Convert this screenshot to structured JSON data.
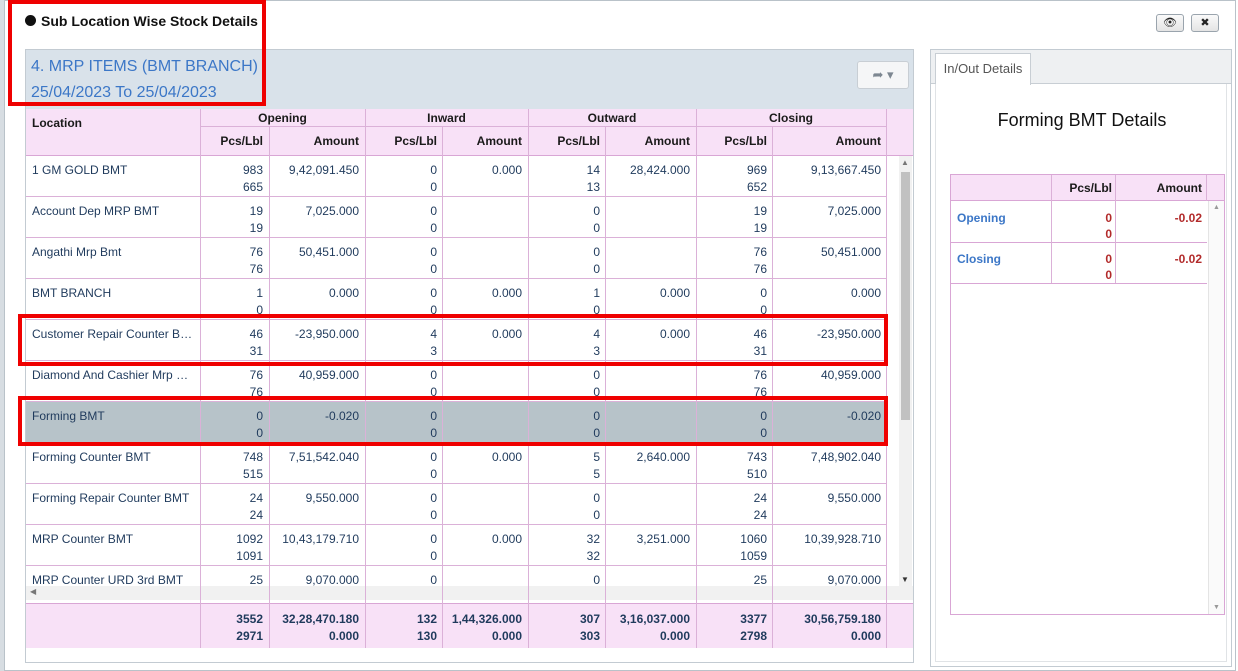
{
  "dialog": {
    "title": "Sub Location Wise Stock Details",
    "btn_view": "👁",
    "btn_close": "✖"
  },
  "panel": {
    "title_line1": "4. MRP ITEMS (BMT BRANCH)",
    "title_line2": "25/04/2023 To 25/04/2023",
    "share_icon": "➦ ▾"
  },
  "grid": {
    "headers": {
      "location": "Location",
      "opening": "Opening",
      "inward": "Inward",
      "outward": "Outward",
      "closing": "Closing",
      "pcs": "Pcs/Lbl",
      "amount": "Amount"
    },
    "rows": [
      {
        "location": "1 GM GOLD BMT",
        "op_pcs": "983",
        "op_lbl": "665",
        "op_amt": "9,42,091.450",
        "in_pcs": "0",
        "in_lbl": "0",
        "in_amt": "0.000",
        "out_pcs": "14",
        "out_lbl": "13",
        "out_amt": "28,424.000",
        "cl_pcs": "969",
        "cl_lbl": "652",
        "cl_amt": "9,13,667.450"
      },
      {
        "location": "Account Dep MRP BMT",
        "op_pcs": "19",
        "op_lbl": "19",
        "op_amt": "7,025.000",
        "in_pcs": "0",
        "in_lbl": "0",
        "in_amt": "",
        "out_pcs": "0",
        "out_lbl": "0",
        "out_amt": "",
        "cl_pcs": "19",
        "cl_lbl": "19",
        "cl_amt": "7,025.000"
      },
      {
        "location": "Angathi Mrp Bmt",
        "op_pcs": "76",
        "op_lbl": "76",
        "op_amt": "50,451.000",
        "in_pcs": "0",
        "in_lbl": "0",
        "in_amt": "",
        "out_pcs": "0",
        "out_lbl": "0",
        "out_amt": "",
        "cl_pcs": "76",
        "cl_lbl": "76",
        "cl_amt": "50,451.000"
      },
      {
        "location": "BMT BRANCH",
        "op_pcs": "1",
        "op_lbl": "0",
        "op_amt": "0.000",
        "in_pcs": "0",
        "in_lbl": "0",
        "in_amt": "0.000",
        "out_pcs": "1",
        "out_lbl": "0",
        "out_amt": "0.000",
        "cl_pcs": "0",
        "cl_lbl": "0",
        "cl_amt": "0.000"
      },
      {
        "location": "Customer Repair Counter BMT",
        "op_pcs": "46",
        "op_lbl": "31",
        "op_amt": "-23,950.000",
        "in_pcs": "4",
        "in_lbl": "3",
        "in_amt": "0.000",
        "out_pcs": "4",
        "out_lbl": "3",
        "out_amt": "0.000",
        "cl_pcs": "46",
        "cl_lbl": "31",
        "cl_amt": "-23,950.000"
      },
      {
        "location": "Diamond And Cashier Mrp BMT",
        "op_pcs": "76",
        "op_lbl": "76",
        "op_amt": "40,959.000",
        "in_pcs": "0",
        "in_lbl": "0",
        "in_amt": "",
        "out_pcs": "0",
        "out_lbl": "0",
        "out_amt": "",
        "cl_pcs": "76",
        "cl_lbl": "76",
        "cl_amt": "40,959.000"
      },
      {
        "location": "Forming BMT",
        "op_pcs": "0",
        "op_lbl": "0",
        "op_amt": "-0.020",
        "in_pcs": "0",
        "in_lbl": "0",
        "in_amt": "",
        "out_pcs": "0",
        "out_lbl": "0",
        "out_amt": "",
        "cl_pcs": "0",
        "cl_lbl": "0",
        "cl_amt": "-0.020"
      },
      {
        "location": "Forming Counter BMT",
        "op_pcs": "748",
        "op_lbl": "515",
        "op_amt": "7,51,542.040",
        "in_pcs": "0",
        "in_lbl": "0",
        "in_amt": "0.000",
        "out_pcs": "5",
        "out_lbl": "5",
        "out_amt": "2,640.000",
        "cl_pcs": "743",
        "cl_lbl": "510",
        "cl_amt": "7,48,902.040"
      },
      {
        "location": "Forming Repair Counter BMT",
        "op_pcs": "24",
        "op_lbl": "24",
        "op_amt": "9,550.000",
        "in_pcs": "0",
        "in_lbl": "0",
        "in_amt": "",
        "out_pcs": "0",
        "out_lbl": "0",
        "out_amt": "",
        "cl_pcs": "24",
        "cl_lbl": "24",
        "cl_amt": "9,550.000"
      },
      {
        "location": "MRP Counter BMT",
        "op_pcs": "1092",
        "op_lbl": "1091",
        "op_amt": "10,43,179.710",
        "in_pcs": "0",
        "in_lbl": "0",
        "in_amt": "0.000",
        "out_pcs": "32",
        "out_lbl": "32",
        "out_amt": "3,251.000",
        "cl_pcs": "1060",
        "cl_lbl": "1059",
        "cl_amt": "10,39,928.710"
      },
      {
        "location": "MRP Counter URD 3rd BMT",
        "op_pcs": "25",
        "op_lbl": "",
        "op_amt": "9,070.000",
        "in_pcs": "0",
        "in_lbl": "",
        "in_amt": "",
        "out_pcs": "0",
        "out_lbl": "",
        "out_amt": "",
        "cl_pcs": "25",
        "cl_lbl": "",
        "cl_amt": "9,070.000"
      }
    ],
    "totals": {
      "op_pcs": "3552",
      "op_lbl": "2971",
      "op_amt": "32,28,470.180",
      "op_amt2": "0.000",
      "in_pcs": "132",
      "in_lbl": "130",
      "in_amt": "1,44,326.000",
      "in_amt2": "0.000",
      "out_pcs": "307",
      "out_lbl": "303",
      "out_amt": "3,16,037.000",
      "out_amt2": "0.000",
      "cl_pcs": "3377",
      "cl_lbl": "2798",
      "cl_amt": "30,56,759.180",
      "cl_amt2": "0.000"
    }
  },
  "right": {
    "tab": "In/Out Details",
    "title": "Forming BMT Details",
    "head_pcs": "Pcs/Lbl",
    "head_amt": "Amount",
    "rows": [
      {
        "label": "Opening",
        "pcs": "0",
        "lbl": "0",
        "amt": "-0.02"
      },
      {
        "label": "Closing",
        "pcs": "0",
        "lbl": "0",
        "amt": "-0.02"
      }
    ]
  },
  "selected_row": 6
}
